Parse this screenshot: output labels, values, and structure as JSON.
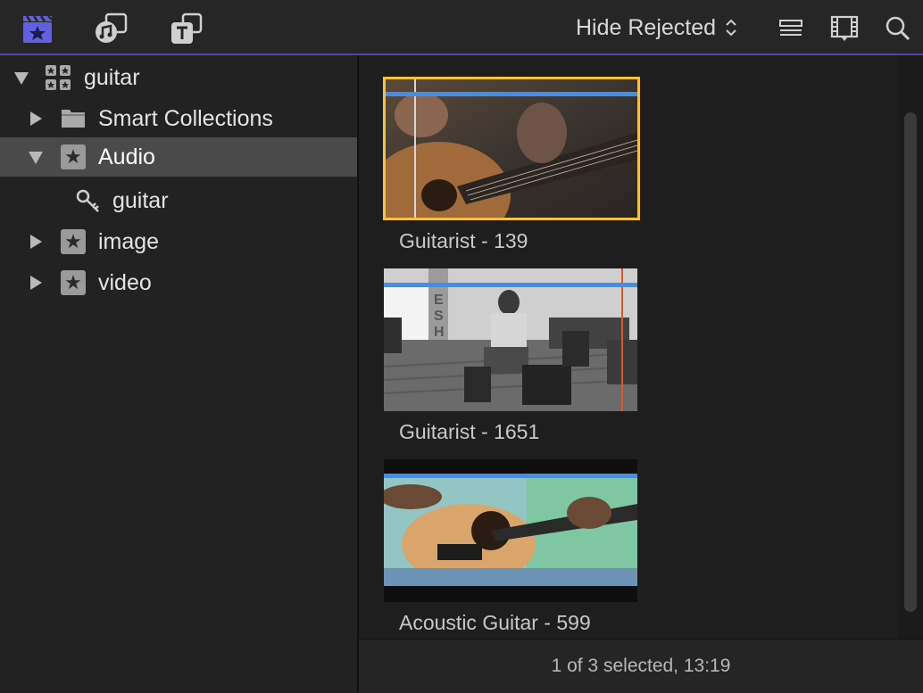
{
  "toolbar": {
    "icons": [
      "libraries-icon",
      "photos-audio-icon",
      "titles-generators-icon",
      "clip-appearance-icon",
      "filmstrip-icon",
      "search-icon"
    ],
    "filter_label": "Hide Rejected",
    "accent_color": "#5b5bd6"
  },
  "sidebar": {
    "library": "guitar",
    "items": [
      {
        "label": "Smart Collections"
      },
      {
        "label": "Audio"
      },
      {
        "label": "guitar"
      },
      {
        "label": "image"
      },
      {
        "label": "video"
      }
    ]
  },
  "browser": {
    "clips": [
      {
        "title": "Guitarist - 139",
        "selected": true
      },
      {
        "title": "Guitarist - 1651",
        "selected": false
      },
      {
        "title": "Acoustic Guitar - 599",
        "selected": false
      }
    ]
  },
  "status": {
    "text": "1 of 3 selected, 13:19"
  }
}
